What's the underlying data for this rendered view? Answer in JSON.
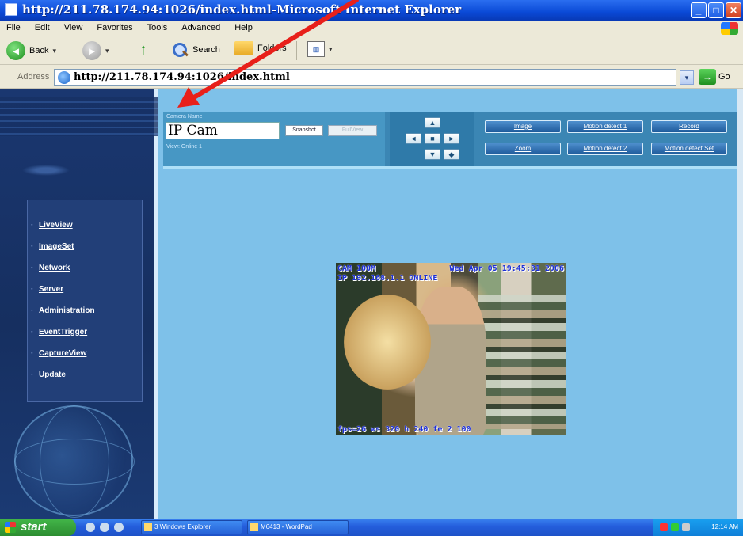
{
  "window": {
    "title": "http://211.78.174.94:1026/index.html-Microsoft Internet Explorer",
    "min_label": "_",
    "max_label": "□",
    "close_label": "✕"
  },
  "menu": [
    "File",
    "Edit",
    "View",
    "Favorites",
    "Tools",
    "Advanced",
    "Help"
  ],
  "toolbar": {
    "back_label": "Back",
    "search_label": "Search",
    "folders_label": "Folders",
    "back_glyph": "◄",
    "forward_glyph": "►",
    "up_glyph": "↑",
    "views_glyph": "▥",
    "dropdown_glyph": "▾"
  },
  "address": {
    "label": "Address",
    "url": "http://211.78.174.94:1026/index.html",
    "go_label": "Go",
    "go_glyph": "→",
    "dropdown_glyph": "▾"
  },
  "sidebar": {
    "items": [
      "LiveView",
      "ImageSet",
      "Network",
      "Server",
      "Administration",
      "EventTrigger",
      "CaptureView",
      "Update"
    ]
  },
  "camera": {
    "name_label": "Camera Name",
    "name": "IP Cam",
    "snapshot_label": "Snapshot",
    "fullview_label": "FullView",
    "status": "View: Online 1"
  },
  "ptz": {
    "up": "▲",
    "left": "◄",
    "home": "■",
    "right": "►",
    "down": "▼",
    "patrol": "◆"
  },
  "functions": [
    "Image",
    "Motion detect 1",
    "Record",
    "Zoom",
    "Motion detect 2",
    "Motion detect Set"
  ],
  "video": {
    "osd_top_left": "CAM 100M",
    "osd_top_right": "Wed Apr 05 19:45:31 2006",
    "osd_line2": "IP 192.168.1.1 ONLINE",
    "osd_bottom": "fps=26 ws 320 h 240 fe 2 100"
  },
  "taskbar": {
    "start_label": "start",
    "tasks": [
      "3 Windows Explorer",
      "M6413 - WordPad"
    ],
    "clock": "12:14 AM"
  },
  "colors": {
    "annotation_arrow": "#e8201a",
    "titlebar": "#0a49d6",
    "content_bg": "#7ec1e9",
    "sidebar_bg": "#1a3770"
  }
}
